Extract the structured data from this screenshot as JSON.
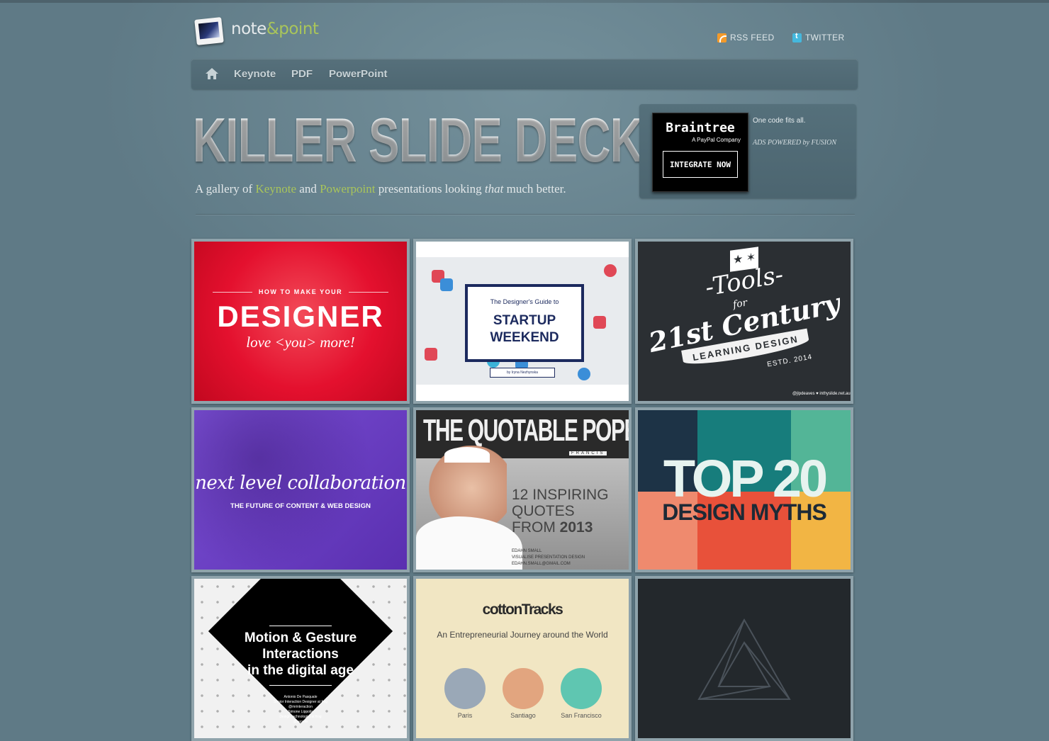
{
  "header": {
    "logo": {
      "note": "note",
      "amp": "&",
      "point": "point"
    },
    "links": [
      {
        "label": "RSS FEED",
        "icon": "rss-icon"
      },
      {
        "label": "TWITTER",
        "icon": "twitter-icon"
      }
    ]
  },
  "nav": {
    "home_icon": "home-icon",
    "items": [
      "Keynote",
      "PDF",
      "PowerPoint"
    ]
  },
  "hero": {
    "headline": "KILLER SLIDE DECKS.",
    "tagline": {
      "prefix": "A gallery of ",
      "keynote": "Keynote",
      "and": " and ",
      "powerpoint": "Powerpoint",
      "middle": " presentations looking ",
      "emph": "that",
      "suffix": " much better."
    }
  },
  "ad": {
    "brand": "Braintree",
    "sub": "A PayPal Company",
    "button": "INTEGRATE NOW",
    "copy": "One code fits all.",
    "powered": "ADS POWERED by FUSION"
  },
  "gallery": [
    {
      "small": "HOW TO MAKE YOUR",
      "big": "DESIGNER",
      "sub": "love <you> more!"
    },
    {
      "t1": "The Designer's Guide to",
      "t2a": "STARTUP",
      "t2b": "WEEKEND",
      "by": "by Iryna Nezhynska"
    },
    {
      "tools": "-Tools-",
      "for": "for",
      "century": "21st Century",
      "ribbon": "LEARNING DESIGN",
      "estd": "ESTD. 2014",
      "credit": "@jlpdeaves ♥ inthyslide.net.au"
    },
    {
      "title": "next level collaboration",
      "sub": "THE FUTURE OF CONTENT & WEB DESIGN"
    },
    {
      "title": "THE QUOTABLE POPE",
      "francis": "FRANCIS",
      "q1": "12 INSPIRING",
      "q2": "QUOTES",
      "q3a": "FROM ",
      "q3b": "2013",
      "c1": "EDAHN SMALL",
      "c2": "VISUALISE  PRESENTATION DESIGN",
      "c3": "EDAHN.SMALL@GMAIL.COM"
    },
    {
      "top": "TOP 20",
      "bottom": "DESIGN MYTHS",
      "colors": [
        "#1d3346",
        "#177d7c",
        "#53b597",
        "#ef8a6e",
        "#e8513a",
        "#f2b544"
      ]
    },
    {
      "l1": "Motion & Gesture",
      "l2": "Interactions",
      "l3": "in the digital age",
      "cr1": "Antonio De Pasquale",
      "cr2": "Senior Interaction Designer at frog",
      "cr3": "@mrinteraction",
      "cr4": "Simone Lippolis",
      "cr5": "Design technologist at frog",
      "cr6": "@sepolis"
    },
    {
      "title": "cottonTracks",
      "sub": "An Entrepreneurial Journey around the World",
      "cities": [
        "Paris",
        "Santiago",
        "San Francisco"
      ]
    },
    {
      "icon": "penrose-triangle-icon"
    }
  ]
}
